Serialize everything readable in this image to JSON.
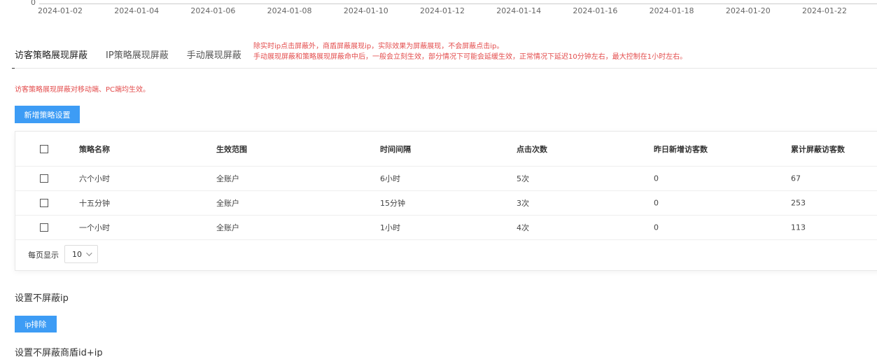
{
  "chart_axis": {
    "zero_label": "0",
    "ticks": [
      "2024-01-02",
      "2024-01-04",
      "2024-01-06",
      "2024-01-08",
      "2024-01-10",
      "2024-01-12",
      "2024-01-14",
      "2024-01-16",
      "2024-01-18",
      "2024-01-20",
      "2024-01-22"
    ]
  },
  "tabs": [
    {
      "label": "访客策略展现屏蔽",
      "active": true
    },
    {
      "label": "IP策略展现屏蔽",
      "active": false
    },
    {
      "label": "手动展现屏蔽",
      "active": false
    }
  ],
  "notice": {
    "line1": "除实时ip点击屏蔽外，商盾屏蔽展现ip，实际效果为屏蔽展现，不会屏蔽点击ip。",
    "line2": "手动展现屏蔽和策略展现屏蔽命中后，一般会立刻生效，部分情况下可能会延缓生效，正常情况下延迟10分钟左右，最大控制在1小时左右。"
  },
  "tip": "访客策略展现屏蔽对移动端、PC端均生效。",
  "add_button": "新增策略设置",
  "table": {
    "headers": [
      "策略名称",
      "生效范围",
      "时间间隔",
      "点击次数",
      "昨日新增访客数",
      "累计屏蔽访客数"
    ],
    "rows": [
      [
        "六个小时",
        "全账户",
        "6小时",
        "5次",
        "0",
        "67"
      ],
      [
        "十五分钟",
        "全账户",
        "15分钟",
        "3次",
        "0",
        "253"
      ],
      [
        "一个小时",
        "全账户",
        "1小时",
        "4次",
        "0",
        "113"
      ]
    ]
  },
  "pager": {
    "label": "每页显示",
    "page_size": "10"
  },
  "section_ip_title": "设置不屏蔽ip",
  "ip_button": "ip排除",
  "section_id_title": "设置不屏蔽商盾id+ip",
  "colors": {
    "primary": "#3d9cf5",
    "warning_text": "#e34d4d"
  }
}
